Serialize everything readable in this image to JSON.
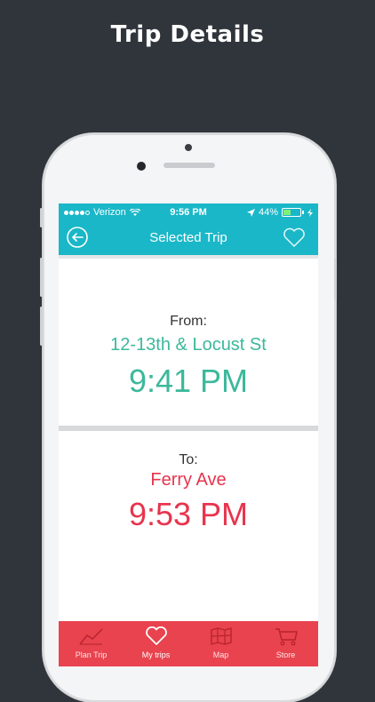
{
  "headline": "Trip Details",
  "status": {
    "carrier": "Verizon",
    "time": "9:56 PM",
    "battery_pct": "44%",
    "battery_level": 0.44
  },
  "nav": {
    "title": "Selected Trip"
  },
  "from": {
    "label": "From:",
    "place": "12-13th & Locust St",
    "time": "9:41 PM"
  },
  "to": {
    "label": "To:",
    "place": "Ferry Ave",
    "time": "9:53 PM"
  },
  "tabs": [
    {
      "label": "Plan Trip",
      "icon": "chart-line-icon"
    },
    {
      "label": "My trips",
      "icon": "heart-icon"
    },
    {
      "label": "Map",
      "icon": "map-icon"
    },
    {
      "label": "Store",
      "icon": "cart-icon"
    }
  ],
  "colors": {
    "teal": "#1ab7c8",
    "green": "#3cb89b",
    "red": "#e8344e",
    "background": "#2f353b"
  }
}
